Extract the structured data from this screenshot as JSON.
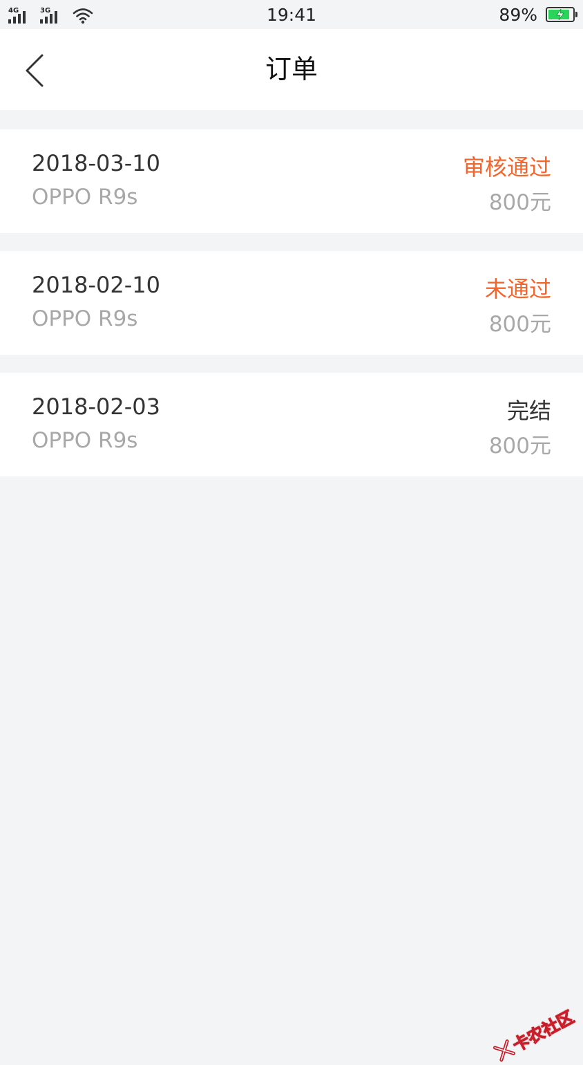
{
  "status_bar": {
    "network_1": "4G",
    "network_2": "3G",
    "time": "19:41",
    "battery_pct": "89%",
    "battery_level": 0.89
  },
  "header": {
    "title": "订单"
  },
  "orders": [
    {
      "date": "2018-03-10",
      "product": "OPPO R9s",
      "status": "审核通过",
      "status_color": "#f2652d",
      "amount": "800元"
    },
    {
      "date": "2018-02-10",
      "product": "OPPO R9s",
      "status": "未通过",
      "status_color": "#f2652d",
      "amount": "800元"
    },
    {
      "date": "2018-02-03",
      "product": "OPPO R9s",
      "status": "完结",
      "status_color": "#333333",
      "amount": "800元"
    }
  ],
  "watermark": {
    "text": "卡农社区"
  },
  "colors": {
    "page_bg": "#f3f4f6",
    "card_bg": "#ffffff",
    "accent_orange": "#f2652d",
    "secondary_text": "#a8a8a8"
  }
}
